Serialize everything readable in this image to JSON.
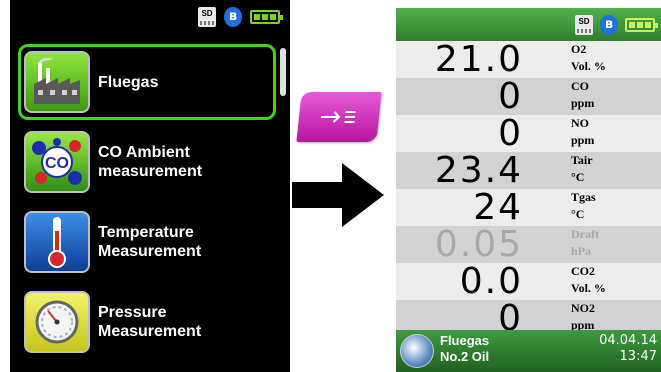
{
  "left_screen": {
    "status": {
      "sd_label": "SD",
      "bluetooth_glyph": "ʙ"
    },
    "menu_items": [
      {
        "label": "Fluegas",
        "icon": "factory-icon",
        "selected": true
      },
      {
        "label": "CO Ambient\nmeasurement",
        "icon": "co-molecule-icon",
        "icon_text": "CO"
      },
      {
        "label": "Temperature\nMeasurement",
        "icon": "thermometer-icon"
      },
      {
        "label": "Pressure\nMeasurement",
        "icon": "pressure-gauge-icon"
      }
    ]
  },
  "key_button": {
    "icon": "enter-list-icon"
  },
  "right_screen": {
    "status": {
      "sd_label": "SD",
      "bluetooth_glyph": "ʙ"
    },
    "measurements": [
      {
        "value": "21.0",
        "name": "O2",
        "unit": "Vol. %",
        "dim": false
      },
      {
        "value": "0",
        "name": "CO",
        "unit": "ppm",
        "dim": false
      },
      {
        "value": "0",
        "name": "NO",
        "unit": "ppm",
        "dim": false
      },
      {
        "value": "23.4",
        "name": "Tair",
        "unit": "°C",
        "dim": false
      },
      {
        "value": "24",
        "name": "Tgas",
        "unit": "°C",
        "dim": false
      },
      {
        "value": "0.05",
        "name": "Draft",
        "unit": "hPa",
        "dim": true
      },
      {
        "value": "0.0",
        "name": "CO2",
        "unit": "Vol. %",
        "dim": false
      },
      {
        "value": "0",
        "name": "NO2",
        "unit": "ppm",
        "dim": false
      }
    ],
    "bottom": {
      "mode": "Fluegas",
      "fuel": "No.2 Oil",
      "date": "04.04.14",
      "time": "13:47"
    }
  },
  "colors": {
    "selection_green": "#44d21e",
    "status_green": "#3b9a38",
    "key_magenta": "#d43cc6"
  }
}
